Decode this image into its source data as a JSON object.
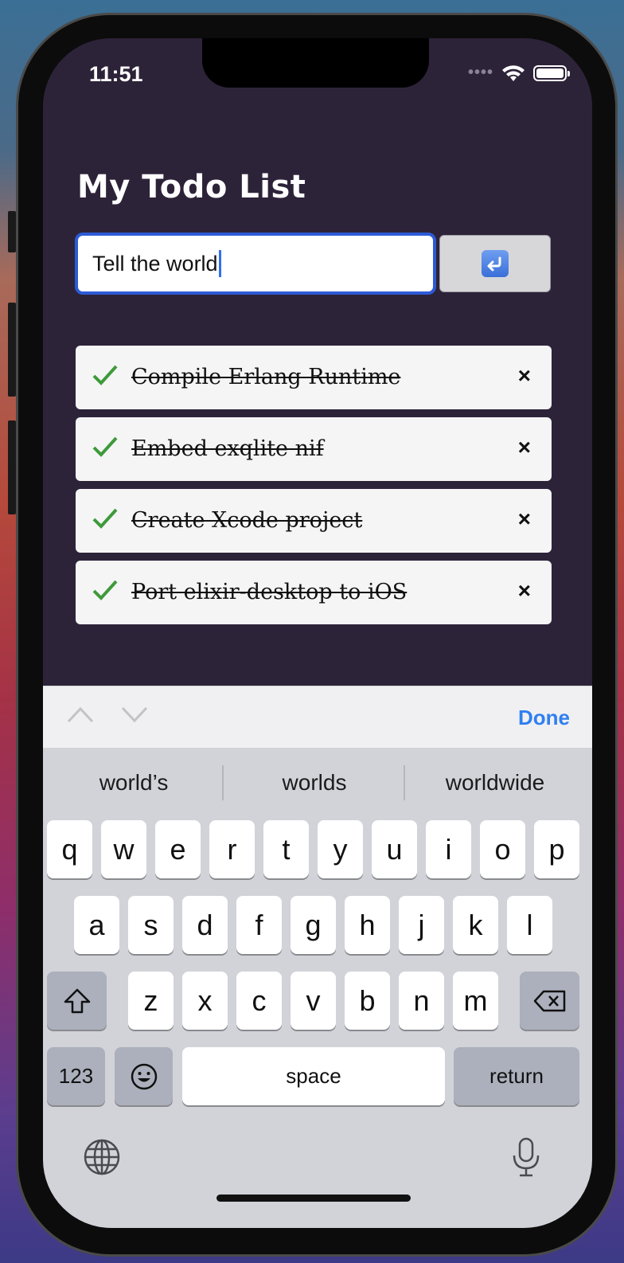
{
  "status_bar": {
    "time": "11:51",
    "signal": "••••"
  },
  "app": {
    "title": "My Todo List",
    "input_value": "Tell the world",
    "todos": [
      {
        "text": "Compile Erlang Runtime",
        "done": true
      },
      {
        "text": "Embed exqlite nif",
        "done": true
      },
      {
        "text": "Create Xcode project",
        "done": true
      },
      {
        "text": "Port elixir-desktop to iOS",
        "done": true
      }
    ],
    "delete_glyph": "×"
  },
  "keyboard_toolbar": {
    "done_label": "Done"
  },
  "keyboard": {
    "suggestions": [
      "world’s",
      "worlds",
      "worldwide"
    ],
    "row1": [
      "q",
      "w",
      "e",
      "r",
      "t",
      "y",
      "u",
      "i",
      "o",
      "p"
    ],
    "row2": [
      "a",
      "s",
      "d",
      "f",
      "g",
      "h",
      "j",
      "k",
      "l"
    ],
    "row3": [
      "z",
      "x",
      "c",
      "v",
      "b",
      "n",
      "m"
    ],
    "numbers_label": "123",
    "space_label": "space",
    "return_label": "return"
  },
  "icons": {
    "check": "check-icon",
    "delete": "close-icon",
    "submit": "return-icon",
    "shift": "shift-icon",
    "backspace": "backspace-icon",
    "emoji": "emoji-icon",
    "globe": "globe-icon",
    "mic": "microphone-icon"
  },
  "colors": {
    "app_background": "#2d2339",
    "input_border": "#2d5bd6",
    "check_green": "#3e9a3a",
    "done_blue": "#2f7ff0"
  }
}
